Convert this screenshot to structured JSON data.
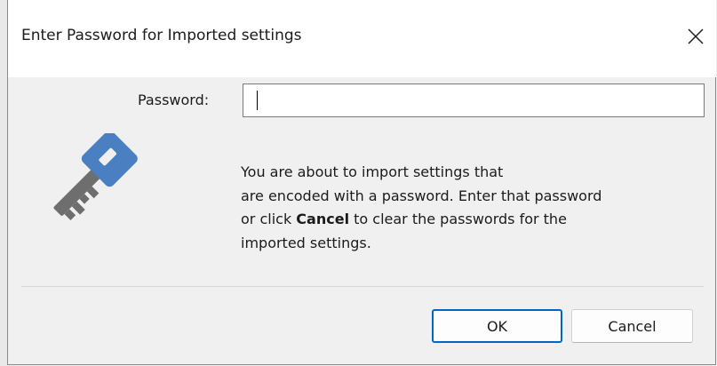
{
  "window": {
    "title": "Enter Password for Imported settings",
    "close_icon": "close-icon"
  },
  "form": {
    "password_label": "Password:",
    "password_value": "",
    "password_placeholder": ""
  },
  "message": {
    "line1": "You are about to import settings that",
    "line2": "are encoded with a password. Enter that password",
    "line3_prefix": "or click ",
    "line3_bold": "Cancel",
    "line3_suffix": " to clear the passwords for the",
    "line4": "imported settings."
  },
  "icons": {
    "main": "key-icon"
  },
  "buttons": {
    "ok_label": "OK",
    "cancel_label": "Cancel"
  },
  "colors": {
    "accent": "#0067c0",
    "key_blue": "#4a7fc1",
    "key_gray": "#6e6e6e"
  }
}
